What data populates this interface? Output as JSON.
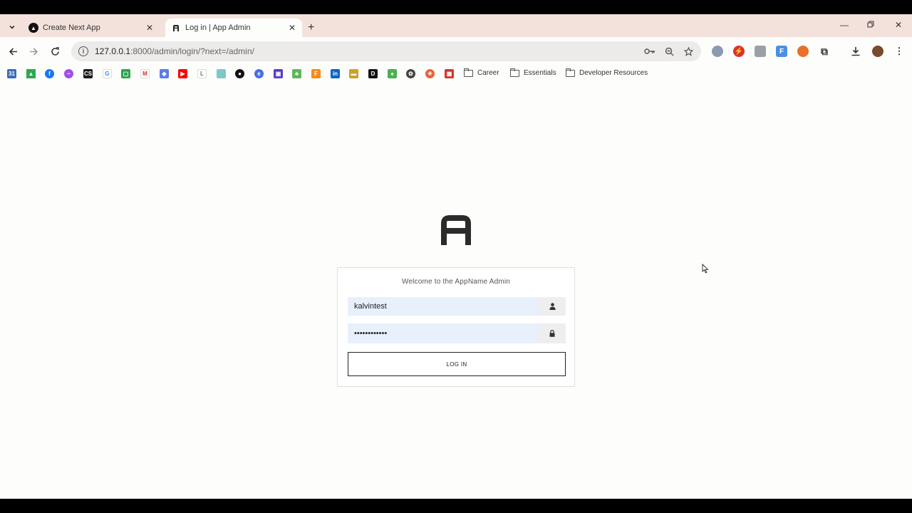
{
  "browser": {
    "tabs": [
      {
        "title": "Create Next App",
        "active": false
      },
      {
        "title": "Log in | App Admin",
        "active": true
      }
    ],
    "url_host": "127.0.0.1",
    "url_rest": ":8000/admin/login/?next=/admin/",
    "bookmark_folders": [
      "Career",
      "Essentials",
      "Developer Resources"
    ]
  },
  "login": {
    "welcome": "Welcome to the AppName Admin",
    "username_value": "kalvintest",
    "password_value": "••••••••••••",
    "button_label": "LOG IN"
  },
  "colors": {
    "field_bg": "#e8f0fb",
    "tab_strip_bg": "#f3e2dc",
    "page_bg": "#fdfdfc"
  }
}
